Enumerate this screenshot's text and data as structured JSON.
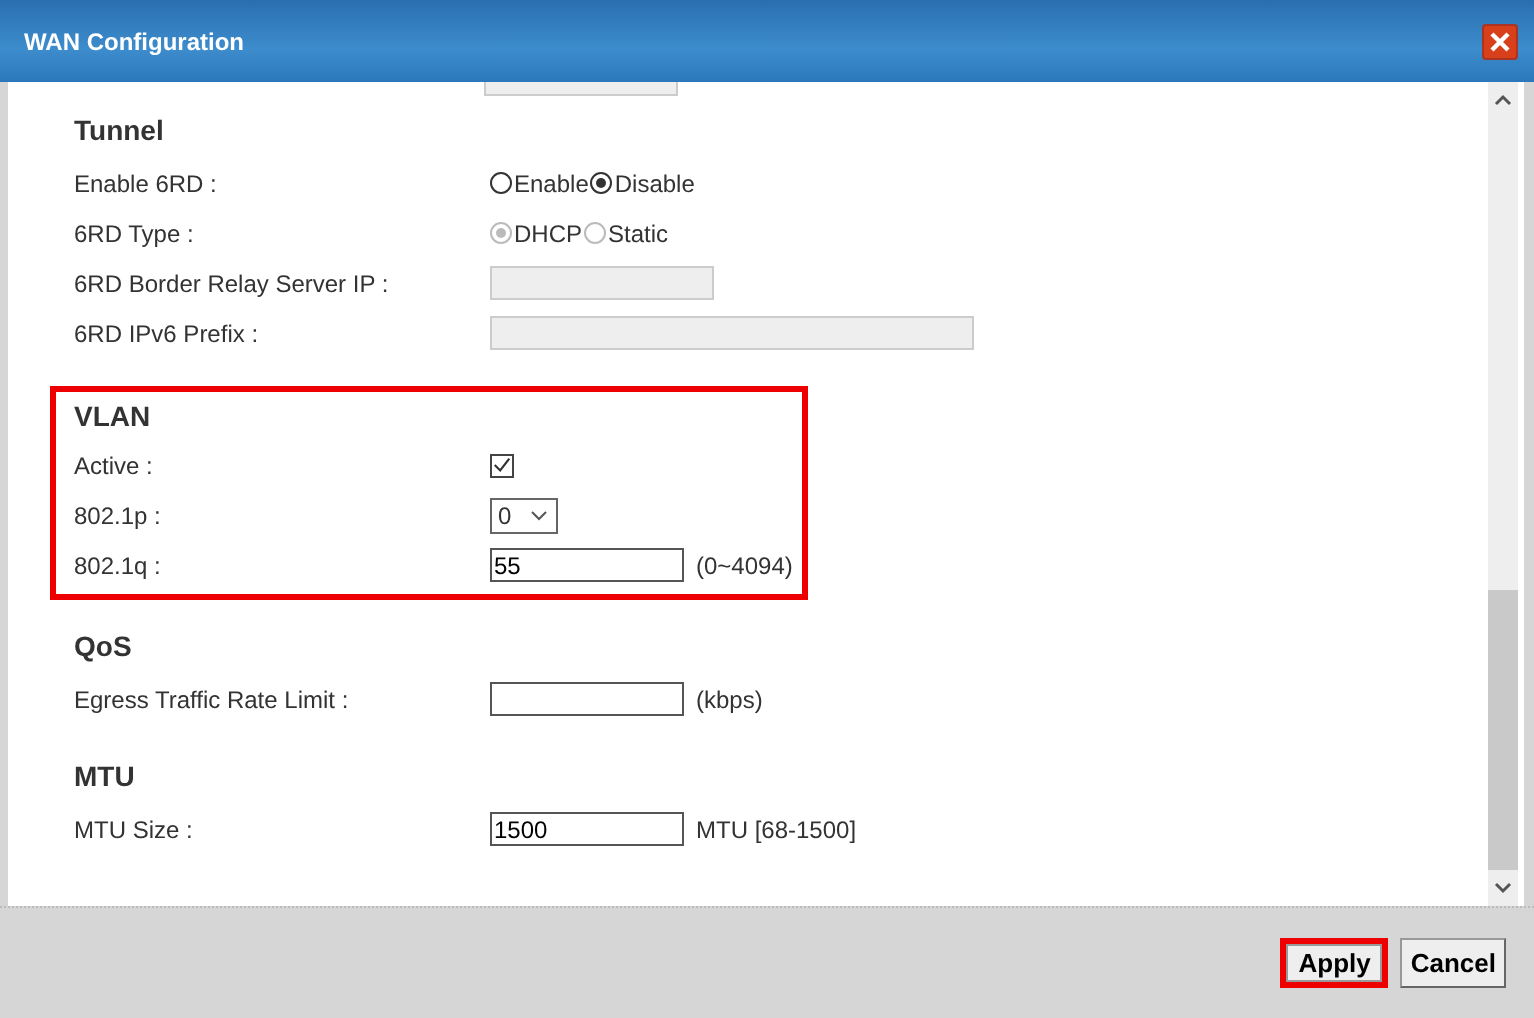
{
  "window": {
    "title": "WAN Configuration"
  },
  "sections": [
    {
      "title": "Tunnel",
      "highlighted": false,
      "rows": [
        {
          "kind": "radio",
          "label": "Enable 6RD :",
          "options": [
            {
              "label": "Enable",
              "selected": false,
              "disabled": false
            },
            {
              "label": "Disable",
              "selected": true,
              "disabled": false
            }
          ]
        },
        {
          "kind": "radio",
          "label": "6RD Type :",
          "options": [
            {
              "label": "DHCP",
              "selected": true,
              "disabled": true
            },
            {
              "label": "Static",
              "selected": false,
              "disabled": true
            }
          ]
        },
        {
          "kind": "field",
          "label": "6RD Border Relay Server IP :",
          "disabled": true
        },
        {
          "kind": "wide-field",
          "label": "6RD IPv6 Prefix :",
          "disabled": true
        }
      ]
    },
    {
      "title": "VLAN",
      "highlighted": true,
      "rows": [
        {
          "kind": "checkbox",
          "label": "Active :",
          "checked": true
        },
        {
          "kind": "select",
          "label": "802.1p :",
          "value": "0"
        },
        {
          "kind": "field",
          "label": "802.1q :",
          "value": "55",
          "suffix": "(0~4094)",
          "disabled": false
        }
      ]
    },
    {
      "title": "QoS",
      "highlighted": false,
      "rows": [
        {
          "kind": "field",
          "label": "Egress Traffic Rate Limit :",
          "suffix": "(kbps)",
          "disabled": false
        }
      ]
    },
    {
      "title": "MTU",
      "highlighted": false,
      "rows": [
        {
          "kind": "field",
          "label": "MTU Size :",
          "value": "1500",
          "suffix": "MTU [68-1500]",
          "disabled": false
        }
      ]
    }
  ],
  "buttons": [
    {
      "label": "Apply",
      "highlighted": true
    },
    {
      "label": "Cancel",
      "highlighted": false
    }
  ]
}
